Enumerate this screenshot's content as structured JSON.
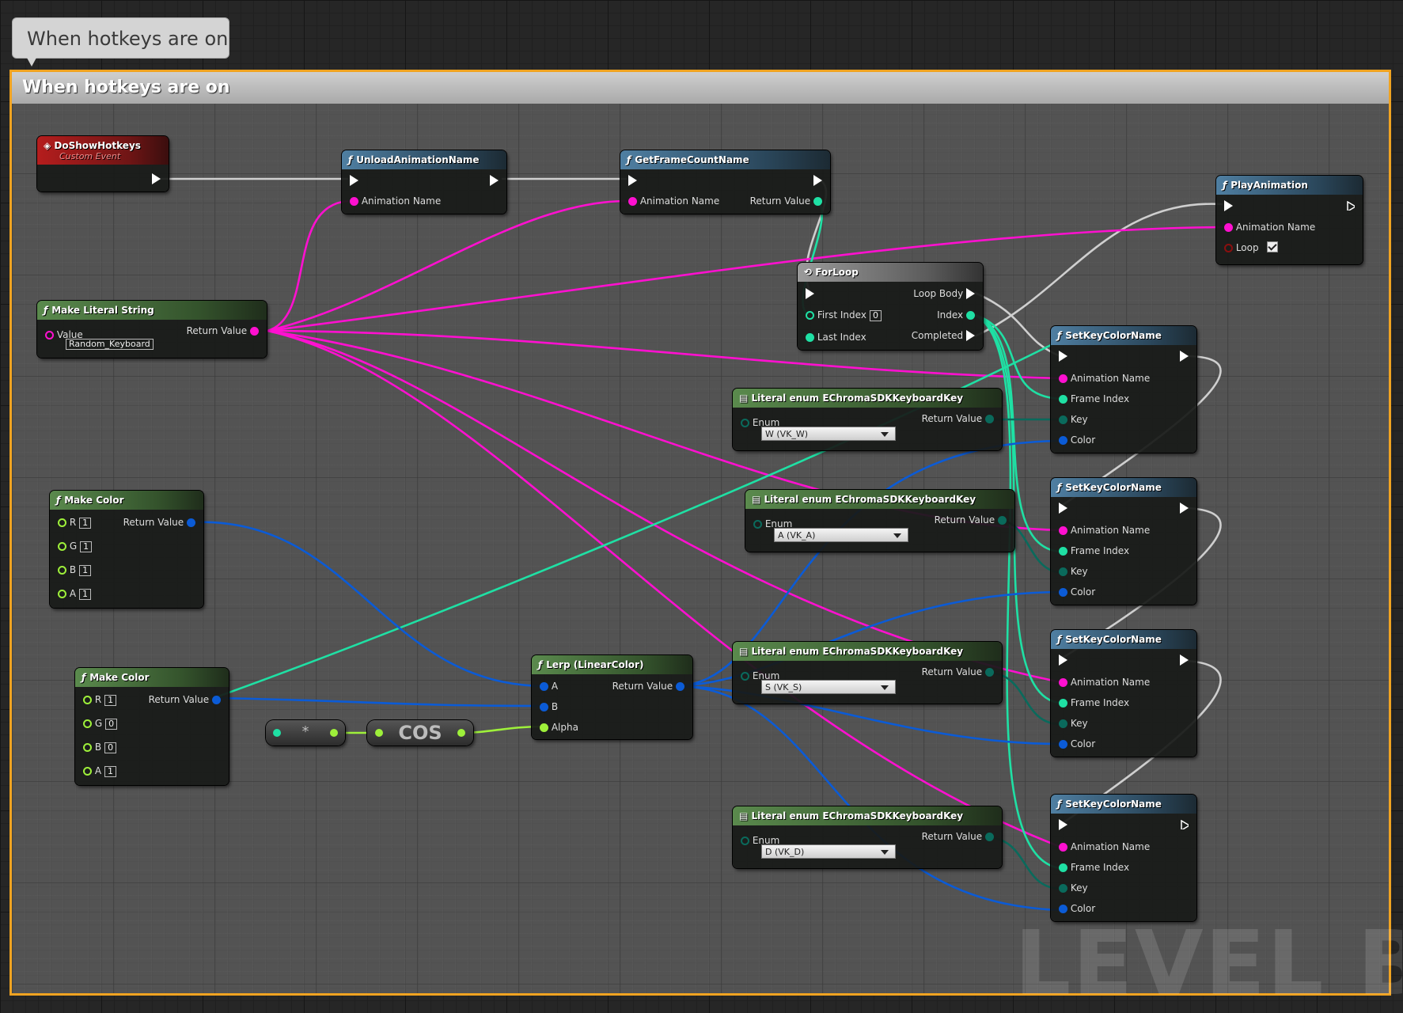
{
  "comment": {
    "bubble_text": "When hotkeys are on",
    "title": "When hotkeys are on",
    "frame_color": "#f0a321"
  },
  "watermark": "LEVEL BLU",
  "nodes": {
    "event": {
      "title": "DoShowHotkeys",
      "subtitle": "Custom Event",
      "icon": "event-diamond-icon"
    },
    "unload": {
      "title": "UnloadAnimationName",
      "pin_anim": "Animation Name"
    },
    "getframe": {
      "title": "GetFrameCountName",
      "pin_anim": "Animation Name",
      "pin_ret": "Return Value"
    },
    "play": {
      "title": "PlayAnimation",
      "pin_anim": "Animation Name",
      "pin_loop": "Loop",
      "loop_checked": true
    },
    "literal_string": {
      "title": "Make Literal String",
      "pin_value": "Value",
      "value": "Random_Keyboard",
      "pin_ret": "Return Value"
    },
    "forloop": {
      "title": "ForLoop",
      "pin_body": "Loop Body",
      "pin_first": "First Index",
      "first_value": "0",
      "pin_index": "Index",
      "pin_last": "Last Index",
      "pin_completed": "Completed"
    },
    "enum_w": {
      "title": "Literal enum EChromaSDKKeyboardKey",
      "pin_enum": "Enum",
      "value": "W (VK_W)",
      "pin_ret": "Return Value"
    },
    "enum_a": {
      "title": "Literal enum EChromaSDKKeyboardKey",
      "pin_enum": "Enum",
      "value": "A (VK_A)",
      "pin_ret": "Return Value"
    },
    "enum_s": {
      "title": "Literal enum EChromaSDKKeyboardKey",
      "pin_enum": "Enum",
      "value": "S (VK_S)",
      "pin_ret": "Return Value"
    },
    "enum_d": {
      "title": "Literal enum EChromaSDKKeyboardKey",
      "pin_enum": "Enum",
      "value": "D (VK_D)",
      "pin_ret": "Return Value"
    },
    "make_color_1": {
      "title": "Make Color",
      "r": "1",
      "g": "1",
      "b": "1",
      "a": "1",
      "pin_ret": "Return Value",
      "pin_r": "R",
      "pin_g": "G",
      "pin_b": "B",
      "pin_a": "A"
    },
    "make_color_2": {
      "title": "Make Color",
      "r": "1",
      "g": "0",
      "b": "0",
      "a": "1",
      "pin_ret": "Return Value",
      "pin_r": "R",
      "pin_g": "G",
      "pin_b": "B",
      "pin_a": "A"
    },
    "multiply": {
      "label": "*"
    },
    "cos": {
      "label": "COS"
    },
    "lerp": {
      "title": "Lerp (LinearColor)",
      "pin_a": "A",
      "pin_b": "B",
      "pin_alpha": "Alpha",
      "pin_ret": "Return Value"
    },
    "setkey": [
      {
        "title": "SetKeyColorName",
        "pin_anim": "Animation Name",
        "pin_frame": "Frame Index",
        "pin_key": "Key",
        "pin_color": "Color"
      },
      {
        "title": "SetKeyColorName",
        "pin_anim": "Animation Name",
        "pin_frame": "Frame Index",
        "pin_key": "Key",
        "pin_color": "Color"
      },
      {
        "title": "SetKeyColorName",
        "pin_anim": "Animation Name",
        "pin_frame": "Frame Index",
        "pin_key": "Key",
        "pin_color": "Color"
      },
      {
        "title": "SetKeyColorName",
        "pin_anim": "Animation Name",
        "pin_frame": "Frame Index",
        "pin_key": "Key",
        "pin_color": "Color"
      }
    ]
  },
  "colors": {
    "string_pin": "#ff10d0",
    "int_pin": "#1fe0a4",
    "struct_pin": "#0b5bd6",
    "enum_pin": "#0a6a5c",
    "float_pin": "#9ef03a",
    "exec_pin": "#ffffff"
  }
}
